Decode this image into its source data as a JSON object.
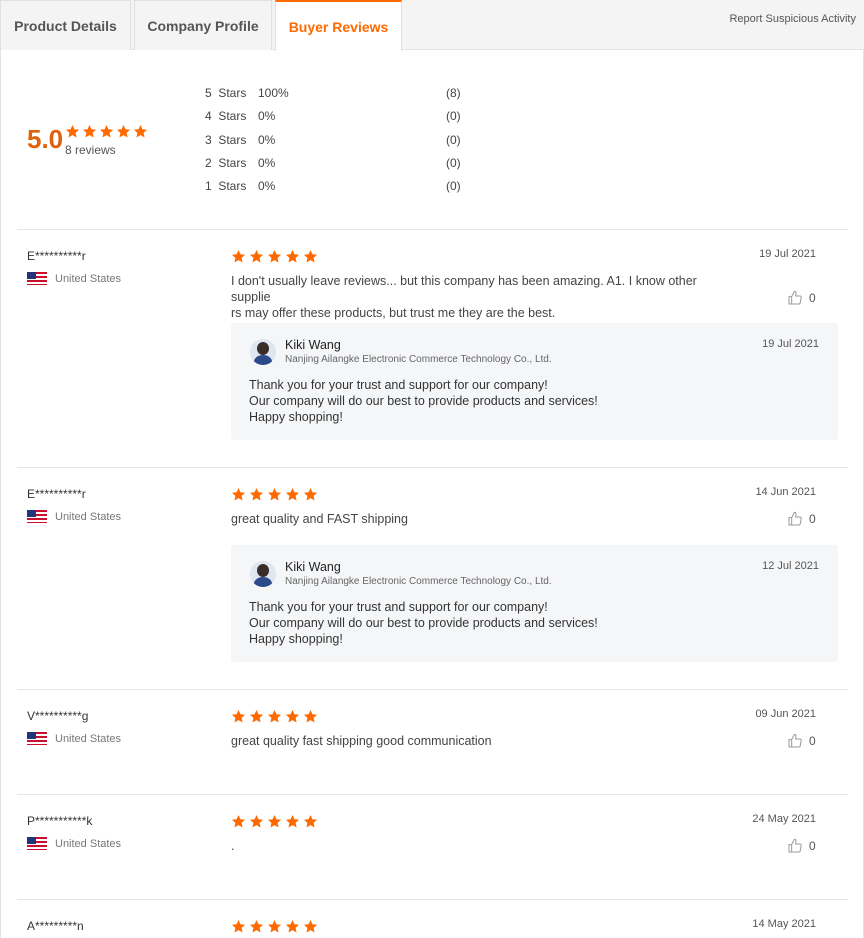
{
  "tabs": [
    {
      "label": "Product Details",
      "active": false
    },
    {
      "label": "Company Profile",
      "active": false
    },
    {
      "label": "Buyer Reviews",
      "active": true
    }
  ],
  "report_link": "Report Suspicious Activity",
  "summary": {
    "score": "5.0",
    "rating_stars": 5,
    "reviews_count": "8 reviews",
    "distribution": [
      {
        "label": "5  Stars",
        "percent": "100%",
        "count": "(8)"
      },
      {
        "label": "4  Stars",
        "percent": "0%",
        "count": "(0)"
      },
      {
        "label": "3  Stars",
        "percent": "0%",
        "count": "(0)"
      },
      {
        "label": "2  Stars",
        "percent": "0%",
        "count": "(0)"
      },
      {
        "label": "1  Stars",
        "percent": "0%",
        "count": "(0)"
      }
    ]
  },
  "reviews": [
    {
      "reviewer": "E**********r",
      "country": "United States",
      "rating": 5,
      "date": "19 Jul 2021",
      "text_lines": [
        "I don't usually leave reviews... but this company has been amazing. A1. I know other supplie",
        "rs may offer these products, but trust me they are the best."
      ],
      "likes": "0",
      "reply": {
        "name": "Kiki Wang",
        "company": "Nanjing Ailangke Electronic Commerce Technology Co., Ltd.",
        "date": "19 Jul 2021",
        "lines": [
          "Thank you for your trust and support for our company!",
          "Our company will do our best to provide products and services!",
          "Happy shopping!"
        ]
      }
    },
    {
      "reviewer": "E**********r",
      "country": "United States",
      "rating": 5,
      "date": "14 Jun 2021",
      "text_lines": [
        "great quality and FAST shipping"
      ],
      "likes": "0",
      "reply": {
        "name": "Kiki Wang",
        "company": "Nanjing Ailangke Electronic Commerce Technology Co., Ltd.",
        "date": "12 Jul 2021",
        "lines": [
          "Thank you for your trust and support for our company!",
          "Our company will do our best to provide products and services!",
          "Happy shopping!"
        ]
      }
    },
    {
      "reviewer": "V**********g",
      "country": "United States",
      "rating": 5,
      "date": "09 Jun 2021",
      "text_lines": [
        "great quality fast shipping good communication"
      ],
      "likes": "0"
    },
    {
      "reviewer": "P***********k",
      "country": "United States",
      "rating": 5,
      "date": "24 May 2021",
      "text_lines": [
        "."
      ],
      "likes": "0"
    },
    {
      "reviewer": "A*********n",
      "country": "",
      "rating": 5,
      "date": "14 May 2021",
      "text_lines": [],
      "likes": ""
    }
  ],
  "colors": {
    "accent": "#ff6a00",
    "score": "#e0600c",
    "reply_bg": "#f5f6f8"
  },
  "icons": [
    "star-icon",
    "thumbs-up-icon",
    "us-flag-icon",
    "avatar"
  ]
}
